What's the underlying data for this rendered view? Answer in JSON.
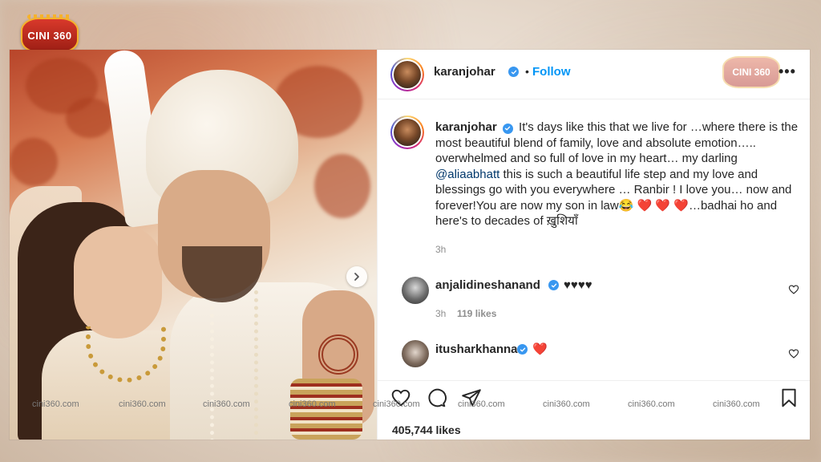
{
  "brand": {
    "logo_text": "CINI 360",
    "watermark_logo_text": "CINI 360"
  },
  "post": {
    "username": "karanjohar",
    "follow_label": "Follow",
    "separator": "•",
    "more_label": "•••",
    "caption": {
      "username": "karanjohar",
      "text_1": "It's days like this that we live for …where there is the most beautiful blend of family, love and absolute emotion….. overwhelmed and so full of love in my heart… my darling",
      "mention": "@aliaabhatt",
      "text_2": "this is such a beautiful life step and my love and blessings go with you everywhere … Ranbir ! I love you… now and forever!You are now my son in law",
      "emojis": "😂 ❤️ ❤️ ❤️",
      "text_3": "…badhai ho and here's to decades of ख़ुशियाँ"
    },
    "caption_time": "3h",
    "comments": [
      {
        "username": "anjalidineshanand",
        "text": "♥♥♥♥",
        "time": "3h",
        "likes": "119 likes"
      },
      {
        "username": "itusharkhanna",
        "text": "❤️"
      }
    ],
    "likes": "405,744 likes"
  },
  "watermarks": [
    "cini360.com",
    "cini360.com",
    "cini360.com",
    "cini360.com",
    "cini360.com",
    "cini360.com",
    "cini360.com",
    "cini360.com",
    "cini360.com"
  ],
  "colors": {
    "accent": "#0095f6",
    "verified": "#3897f0",
    "heart": "#e0192b",
    "brand_red": "#d9392b"
  },
  "icons": [
    "chevron-right-icon",
    "verified-badge-icon",
    "heart-outline-icon",
    "comment-icon",
    "share-icon",
    "bookmark-icon"
  ]
}
